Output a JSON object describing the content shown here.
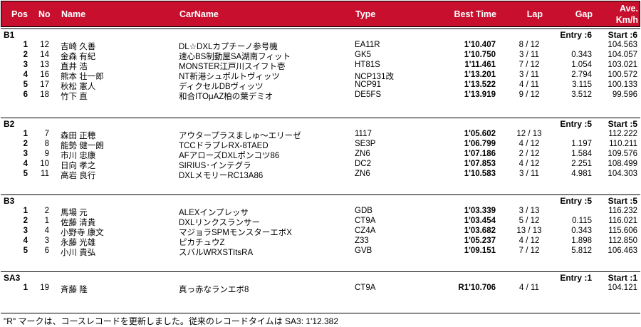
{
  "header": {
    "pos": "Pos",
    "no": "No",
    "name": "Name",
    "carname": "CarName",
    "type": "Type",
    "best_time": "Best Time",
    "lap": "Lap",
    "gap": "Gap",
    "ave1": "Ave.",
    "ave2": "Km/h"
  },
  "classes": [
    {
      "label": "B1",
      "entry": "Entry :6",
      "start": "Start :6",
      "rows": [
        {
          "pos": "1",
          "no": "12",
          "name": "吉崎 久善",
          "car": "DL☆DXLカプチーノ参号機",
          "type": "EA11R",
          "best": "1'10.407",
          "lap": "8 / 12",
          "gap": "",
          "speed": "104.563"
        },
        {
          "pos": "2",
          "no": "14",
          "name": "金森 有紀",
          "car": "速心BS制動屋SA湖南フィット",
          "type": "GK5",
          "best": "1'10.750",
          "lap": "3 / 11",
          "gap": "0.343",
          "speed": "104.057"
        },
        {
          "pos": "3",
          "no": "13",
          "name": "直井 浩",
          "car": "MONSTER江戸川スイフト壱",
          "type": "HT81S",
          "best": "1'11.461",
          "lap": "7 / 12",
          "gap": "1.054",
          "speed": "103.021"
        },
        {
          "pos": "4",
          "no": "16",
          "name": "熊本 壮一郎",
          "car": "NT新港シュポルトヴィッツ",
          "type": "NCP131改",
          "best": "1'13.201",
          "lap": "3 / 11",
          "gap": "2.794",
          "speed": "100.572"
        },
        {
          "pos": "5",
          "no": "17",
          "name": "秋松 憲人",
          "car": "ディクセルDBヴィッツ",
          "type": "NCP91",
          "best": "1'13.522",
          "lap": "4 / 11",
          "gap": "3.115",
          "speed": "100.133"
        },
        {
          "pos": "6",
          "no": "18",
          "name": "竹下 直",
          "car": "和合ITOμAZ柏の葉デミオ",
          "type": "DE5FS",
          "best": "1'13.919",
          "lap": "9 / 12",
          "gap": "3.512",
          "speed": "99.596"
        }
      ]
    },
    {
      "label": "B2",
      "entry": "Entry :5",
      "start": "Start :5",
      "rows": [
        {
          "pos": "1",
          "no": "7",
          "name": "森田 正穂",
          "car": "アウタープラスましゅ～エリーゼ",
          "type": "1117",
          "best": "1'05.602",
          "lap": "12 / 13",
          "gap": "",
          "speed": "112.222"
        },
        {
          "pos": "2",
          "no": "8",
          "name": "能勢 健一朗",
          "car": "TCCドラプレRX-8TAED",
          "type": "SE3P",
          "best": "1'06.799",
          "lap": "4 / 12",
          "gap": "1.197",
          "speed": "110.211"
        },
        {
          "pos": "3",
          "no": "9",
          "name": "市川 忠康",
          "car": "AFアローズDXLポンコツ86",
          "type": "ZN6",
          "best": "1'07.186",
          "lap": "2 / 12",
          "gap": "1.584",
          "speed": "109.576"
        },
        {
          "pos": "4",
          "no": "10",
          "name": "日向 孝之",
          "car": "SIRIUS･インテグラ",
          "type": "DC2",
          "best": "1'07.853",
          "lap": "4 / 12",
          "gap": "2.251",
          "speed": "108.499"
        },
        {
          "pos": "5",
          "no": "11",
          "name": "高岩 良行",
          "car": "DXLメモリーRC13A86",
          "type": "ZN6",
          "best": "1'10.583",
          "lap": "3 / 11",
          "gap": "4.981",
          "speed": "104.303"
        }
      ]
    },
    {
      "label": "B3",
      "entry": "Entry :5",
      "start": "Start :5",
      "rows": [
        {
          "pos": "1",
          "no": "2",
          "name": "馬場 元",
          "car": "ALEXインプレッサ",
          "type": "GDB",
          "best": "1'03.339",
          "lap": "3 / 13",
          "gap": "",
          "speed": "116.232"
        },
        {
          "pos": "2",
          "no": "1",
          "name": "佐藤 清貴",
          "car": "DXLリンクスランサー",
          "type": "CT9A",
          "best": "1'03.454",
          "lap": "5 / 12",
          "gap": "0.115",
          "speed": "116.021"
        },
        {
          "pos": "3",
          "no": "4",
          "name": "小野寺 康文",
          "car": "マジョラSPMモンスターエボX",
          "type": "CZ4A",
          "best": "1'03.682",
          "lap": "13 / 13",
          "gap": "0.343",
          "speed": "115.606"
        },
        {
          "pos": "4",
          "no": "3",
          "name": "永藤 光雄",
          "car": "ピカチュウZ",
          "type": "Z33",
          "best": "1'05.237",
          "lap": "4 / 12",
          "gap": "1.898",
          "speed": "112.850"
        },
        {
          "pos": "5",
          "no": "6",
          "name": "小川 貴弘",
          "car": "スバルWRXSTItsRA",
          "type": "GVB",
          "best": "1'09.151",
          "lap": "7 / 12",
          "gap": "5.812",
          "speed": "106.463"
        }
      ]
    },
    {
      "label": "SA3",
      "entry": "Entry :1",
      "start": "Start :1",
      "rows": [
        {
          "pos": "1",
          "no": "19",
          "name": "斉藤 隆",
          "car": "真っ赤なランエボ8",
          "type": "CT9A",
          "best": "R1'10.706",
          "lap": "4 / 11",
          "gap": "",
          "speed": "104.121"
        }
      ]
    }
  ],
  "footer": "\"R\" マークは、コースレコードを更新しました。従来のレコードタイムは SA3: 1'12.382",
  "colors": {
    "header_bg": "#c8102e",
    "header_text": "#ffffff"
  }
}
